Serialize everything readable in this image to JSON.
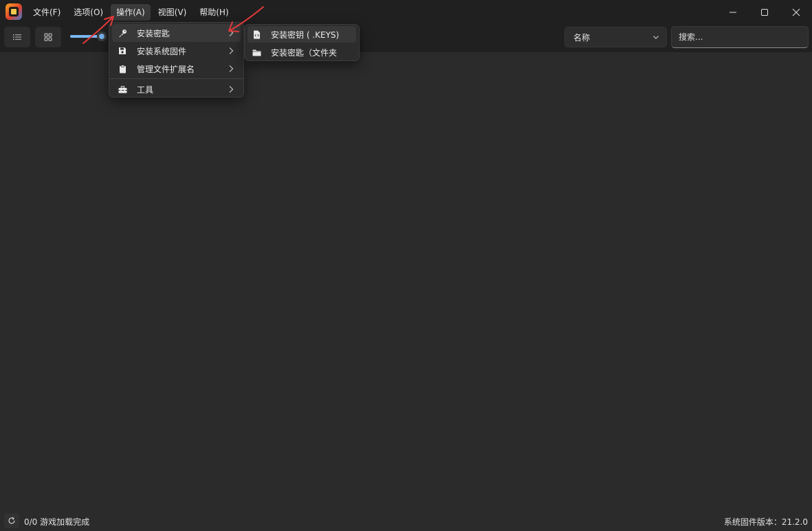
{
  "menubar": {
    "items": [
      "文件(F)",
      "选项(O)",
      "操作(A)",
      "视图(V)",
      "帮助(H)"
    ]
  },
  "toolbar": {
    "list_view": "list-icon",
    "grid_view": "grid-icon",
    "size_slider_level": 0.85,
    "sort": {
      "selected": "名称"
    },
    "search": {
      "placeholder": "搜索..."
    }
  },
  "actions_menu": {
    "items": [
      {
        "label": "安装密匙",
        "icon": "key-icon",
        "has_submenu": true
      },
      {
        "label": "安装系统固件",
        "icon": "save-icon",
        "has_submenu": true
      },
      {
        "label": "管理文件扩展名",
        "icon": "clipboard-icon",
        "has_submenu": true
      },
      {
        "label": "工具",
        "icon": "toolbox-icon",
        "has_submenu": true
      }
    ]
  },
  "keys_submenu": {
    "items": [
      {
        "label": "安装密钥 ( .KEYS)",
        "icon": "file-code-icon"
      },
      {
        "label": "安装密匙（文件夹",
        "icon": "folder-icon"
      }
    ]
  },
  "status": {
    "games_loaded": "0/0 游戏加载完成",
    "firmware_version": "系统固件版本：21.2.0"
  },
  "colors": {
    "background": "#2b2b2b",
    "chrome": "#202020",
    "accent": "#7ab7f0",
    "annotation_arrow": "#e23a3a"
  }
}
